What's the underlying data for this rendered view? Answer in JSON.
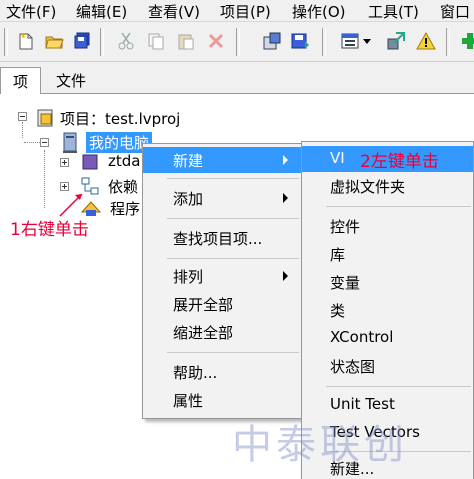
{
  "menubar": {
    "items": [
      "文件(F)",
      "编辑(E)",
      "查看(V)",
      "项目(P)",
      "操作(O)",
      "工具(T)",
      "窗口"
    ]
  },
  "toolbar": {
    "icons": [
      "new-vi-icon",
      "open-folder-icon",
      "save-all-icon",
      "cut-icon",
      "copy-icon",
      "paste-icon",
      "delete-icon",
      "build-icon",
      "save-icon",
      "view-icon",
      "dropdown-arrow-icon",
      "deploy-icon",
      "warning-icon",
      "add-icon"
    ]
  },
  "tabs": [
    "项",
    "文件"
  ],
  "tree": {
    "project_label": "项目：test.lvproj",
    "my_computer": "我的电脑",
    "child_1": "ztda",
    "child_2": "依赖",
    "child_3": "程序"
  },
  "context_menu": {
    "new": "新建",
    "add": "添加",
    "find_items": "查找项目项...",
    "arrange": "排列",
    "expand_all": "展开全部",
    "collapse_all": "缩进全部",
    "help": "帮助...",
    "properties": "属性"
  },
  "submenu": {
    "vi": "VI",
    "virtual_folder": "虚拟文件夹",
    "control": "控件",
    "library": "库",
    "variable": "变量",
    "class": "类",
    "xcontrol": "XControl",
    "statechart": "状态图",
    "unit_test": "Unit Test",
    "test_vectors": "Test Vectors",
    "new_dots": "新建..."
  },
  "annotations": {
    "right_click": "1右键单击",
    "left_click": "2左键单击"
  },
  "watermark": "中泰联创",
  "colors": {
    "highlight": "#3399ff",
    "annotation": "#e8003a",
    "menu_bg": "#f2f2f2"
  }
}
